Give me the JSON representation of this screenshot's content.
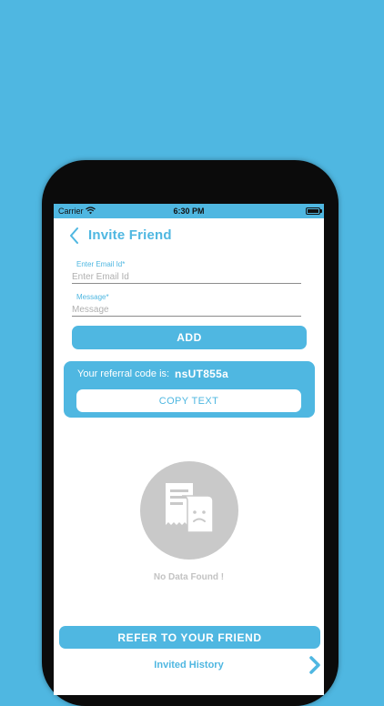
{
  "status_bar": {
    "carrier": "Carrier",
    "time": "6:30 PM"
  },
  "nav": {
    "title": "Invite Friend"
  },
  "form": {
    "email": {
      "label": "Enter Email Id*",
      "placeholder": "Enter Email Id",
      "value": ""
    },
    "message": {
      "label": "Message*",
      "placeholder": "Message",
      "value": ""
    },
    "add_label": "ADD"
  },
  "referral": {
    "label": "Your referral code is:",
    "code": "nsUT855a",
    "copy_label": "COPY TEXT"
  },
  "empty_state": {
    "text": "No Data Found !",
    "icon": "no-receipts-icon"
  },
  "footer": {
    "refer_label": "REFER TO YOUR FRIEND",
    "history_label": "Invited History"
  },
  "colors": {
    "accent": "#4fb7e1",
    "placeholder": "#b0b0b0",
    "empty_gray": "#c9c9c9"
  }
}
